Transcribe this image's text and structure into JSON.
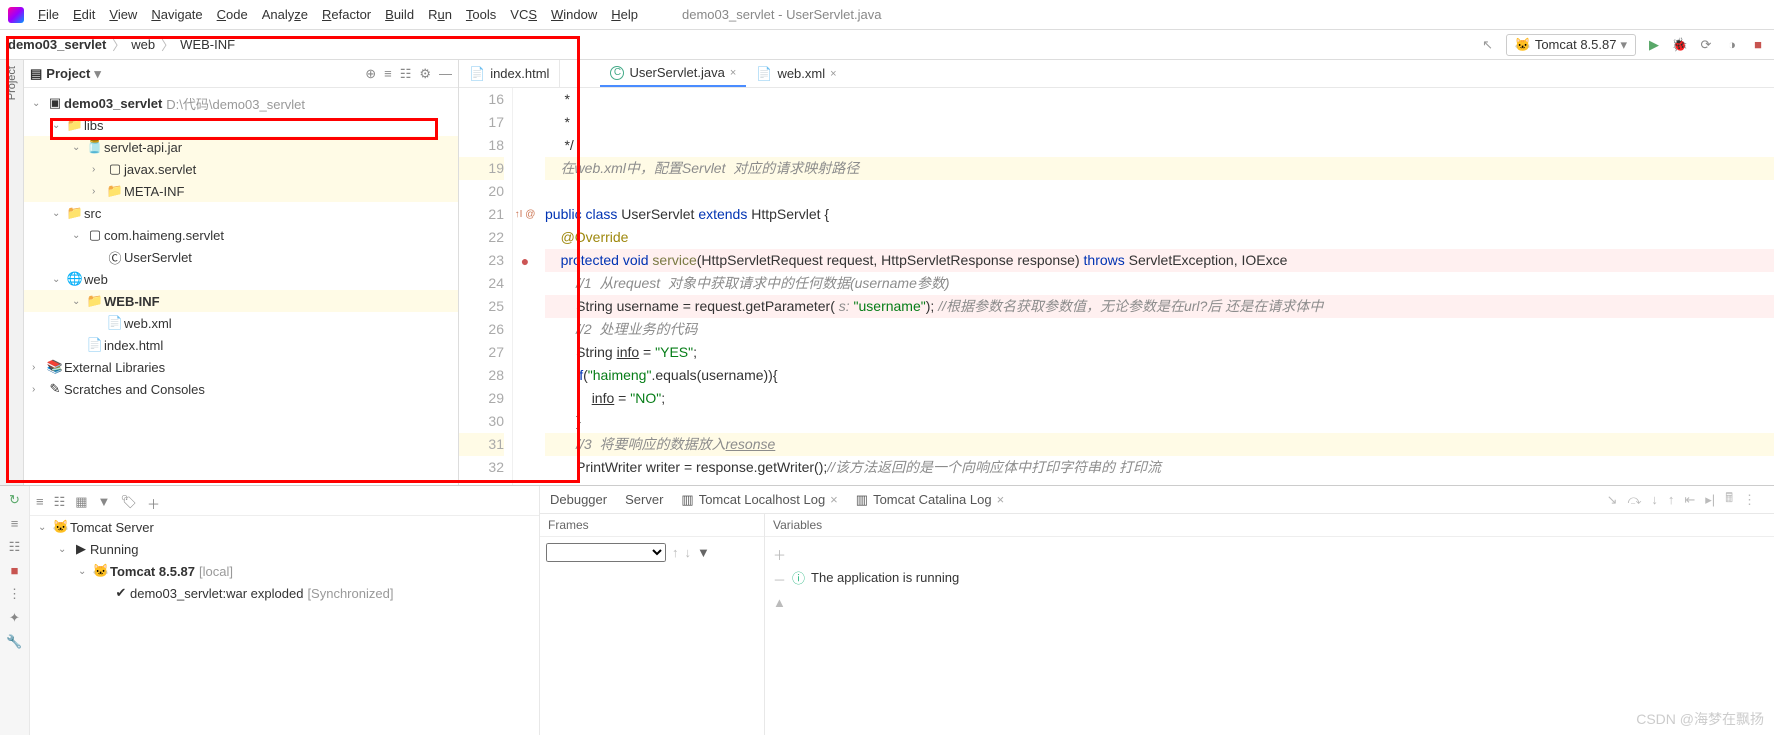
{
  "menu": {
    "items": [
      "File",
      "Edit",
      "View",
      "Navigate",
      "Code",
      "Analyze",
      "Refactor",
      "Build",
      "Run",
      "Tools",
      "VCS",
      "Window",
      "Help"
    ]
  },
  "window_title": "demo03_servlet - UserServlet.java",
  "breadcrumb": [
    "demo03_servlet",
    "web",
    "WEB-INF"
  ],
  "run_config": {
    "name": "Tomcat 8.5.87"
  },
  "project": {
    "title": "Project",
    "root": {
      "name": "demo03_servlet",
      "path": "D:\\代码\\demo03_servlet"
    },
    "nodes": [
      {
        "depth": 0,
        "exp": "v",
        "ico": "module",
        "label": "demo03_servlet",
        "path": "D:\\代码\\demo03_servlet",
        "bold": true
      },
      {
        "depth": 1,
        "exp": "v",
        "ico": "folder",
        "label": "libs"
      },
      {
        "depth": 2,
        "exp": "v",
        "ico": "jar",
        "label": "servlet-api.jar",
        "hl": true
      },
      {
        "depth": 3,
        "exp": ">",
        "ico": "pkg",
        "label": "javax.servlet",
        "hl": true
      },
      {
        "depth": 3,
        "exp": ">",
        "ico": "folder",
        "label": "META-INF",
        "hl": true
      },
      {
        "depth": 1,
        "exp": "v",
        "ico": "src",
        "label": "src"
      },
      {
        "depth": 2,
        "exp": "v",
        "ico": "pkg",
        "label": "com.haimeng.servlet"
      },
      {
        "depth": 3,
        "exp": "",
        "ico": "class",
        "label": "UserServlet"
      },
      {
        "depth": 1,
        "exp": "v",
        "ico": "web",
        "label": "web"
      },
      {
        "depth": 2,
        "exp": "v",
        "ico": "folder",
        "label": "WEB-INF",
        "bold": true,
        "sel": true
      },
      {
        "depth": 3,
        "exp": "",
        "ico": "xml",
        "label": "web.xml"
      },
      {
        "depth": 2,
        "exp": "",
        "ico": "html",
        "label": "index.html"
      },
      {
        "depth": 0,
        "exp": ">",
        "ico": "lib",
        "label": "External Libraries"
      },
      {
        "depth": 0,
        "exp": ">",
        "ico": "scratch",
        "label": "Scratches and Consoles"
      }
    ]
  },
  "editor_tabs": {
    "extra": "index.html",
    "tabs": [
      {
        "label": "UserServlet.java",
        "icon": "class",
        "active": true
      },
      {
        "label": "web.xml",
        "icon": "xml",
        "active": false
      }
    ]
  },
  "code": {
    "lines": [
      {
        "n": 16,
        "html": "     *"
      },
      {
        "n": 17,
        "html": "     *"
      },
      {
        "n": 18,
        "html": "     */"
      },
      {
        "n": 19,
        "html": "    <span class='c'>在web.xml中，配置Servlet  对应的请求映射路径</span>",
        "offset": true,
        "hl": true
      },
      {
        "n": 20,
        "html": ""
      },
      {
        "n": 21,
        "html": "<span class='k'>public</span> <span class='k'>class</span> UserServlet <span class='k'>extends</span> HttpServlet {",
        "gi": "impl"
      },
      {
        "n": 22,
        "html": "    <span class='ann'>@Override</span>"
      },
      {
        "n": 23,
        "html": "    <span class='k'>protected</span> <span class='k'>void</span> <span class='fn'>service</span>(HttpServletRequest request, HttpServletResponse response) <span class='k'>throws</span> ServletException, IOExce",
        "gi": "override",
        "warn": true
      },
      {
        "n": 24,
        "html": "        <span class='c'>//1  从request  对象中获取请求中的任何数据(username参数)</span>"
      },
      {
        "n": 25,
        "html": "        String username = request.getParameter( <span class='c'>s:</span> <span class='s'>\"username\"</span>); <span class='c'>//根据参数名获取参数值，无论参数是在url?后 还是在请求体中</span>",
        "warn": true
      },
      {
        "n": 26,
        "html": "        <span class='c'>//2  处理业务的代码</span>"
      },
      {
        "n": 27,
        "html": "        String <u>info</u> = <span class='s'>\"YES\"</span>;"
      },
      {
        "n": 28,
        "html": "        <span class='k'>if</span>(<span class='s'>\"haimeng\"</span>.equals(username)){"
      },
      {
        "n": 29,
        "html": "            <u>info</u> = <span class='s'>\"NO\"</span>;"
      },
      {
        "n": 30,
        "html": "        }"
      },
      {
        "n": 31,
        "html": "        <span class='c'>//3  将要响应的数据放入<u>resonse</u></span>",
        "hl": true
      },
      {
        "n": 32,
        "html": "        PrintWriter writer = response.getWriter();<span class='c'>//该方法返回的是一个向响应体中打印字符串的 打印流</span>"
      }
    ]
  },
  "services": {
    "title": "Services",
    "tabs": [
      "Debugger",
      "Server",
      "Tomcat Localhost Log",
      "Tomcat Catalina Log"
    ],
    "tree": [
      {
        "depth": 0,
        "exp": "v",
        "ico": "tomcat",
        "label": "Tomcat Server"
      },
      {
        "depth": 1,
        "exp": "v",
        "ico": "run",
        "label": "Running"
      },
      {
        "depth": 2,
        "exp": "v",
        "ico": "tomcat",
        "label": "Tomcat 8.5.87",
        "suffix": "[local]",
        "bold": true
      },
      {
        "depth": 3,
        "exp": "",
        "ico": "artifact",
        "label": "demo03_servlet:war exploded",
        "suffix": "[Synchronized]"
      }
    ],
    "frames": {
      "title": "Frames"
    },
    "variables": {
      "title": "Variables",
      "message": "The application is running"
    }
  },
  "watermark": "CSDN @海梦在飘扬"
}
